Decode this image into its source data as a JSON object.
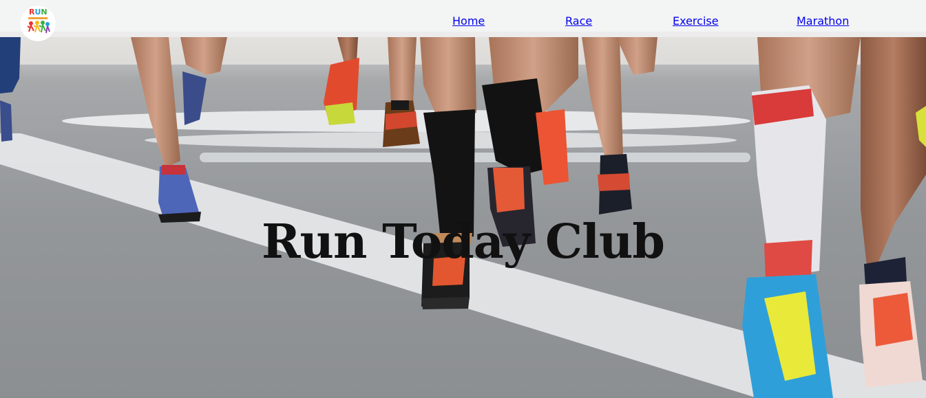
{
  "header": {
    "logo": {
      "icon": "run-club-logo",
      "text_line": "RUN"
    },
    "nav": [
      {
        "label": "Home"
      },
      {
        "label": "Race"
      },
      {
        "label": "Exercise"
      },
      {
        "label": "Marathon"
      }
    ]
  },
  "hero": {
    "title": "Run Today Club",
    "image": "runners-legs-on-road-photo"
  },
  "colors": {
    "header_bg": "#f3f4f4",
    "link": "#0000ee",
    "title": "#111111"
  }
}
